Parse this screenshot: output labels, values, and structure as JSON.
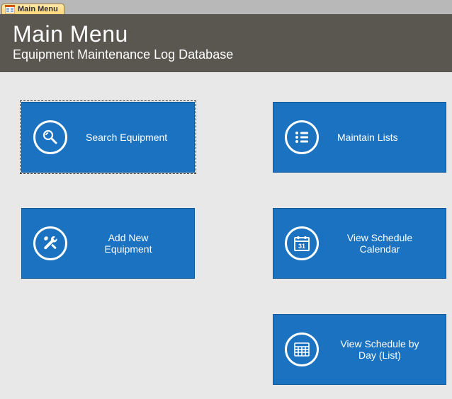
{
  "tab": {
    "label": "Main Menu"
  },
  "header": {
    "title": "Main Menu",
    "subtitle": "Equipment Maintenance Log Database"
  },
  "tiles": {
    "search_equipment": {
      "label": "Search Equipment",
      "icon": "search-icon"
    },
    "maintain_lists": {
      "label": "Maintain Lists",
      "icon": "list-icon"
    },
    "add_new_equipment": {
      "label": "Add New Equipment",
      "icon": "tools-icon"
    },
    "view_schedule_calendar": {
      "label": "View Schedule Calendar",
      "icon": "calendar-icon"
    },
    "view_schedule_by_day": {
      "label": "View Schedule by Day (List)",
      "icon": "grid-icon"
    }
  }
}
